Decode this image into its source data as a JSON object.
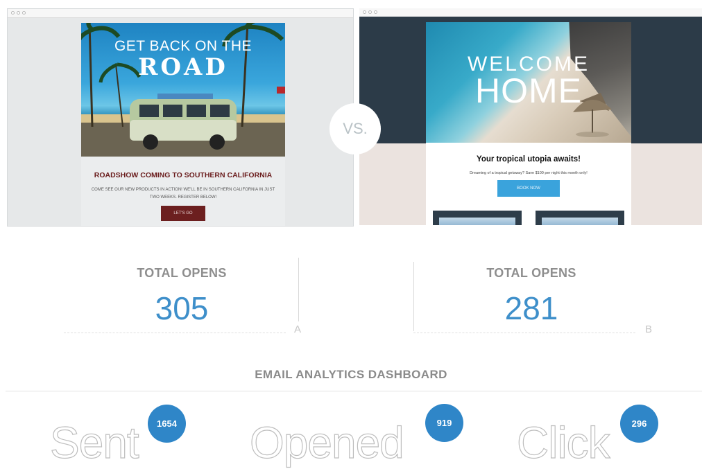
{
  "variant_a": {
    "hero_line1": "GET BACK ON THE",
    "hero_line2": "ROAD",
    "headline": "ROADSHOW COMING TO SOUTHERN CALIFORNIA",
    "body": "COME SEE OUR NEW PRODUCTS IN ACTION! WE'LL BE IN SOUTHERN CALIFORNIA IN JUST TWO WEEKS. REGISTER BELOW!",
    "button": "LET'S GO",
    "stat_label": "TOTAL OPENS",
    "stat_value": "305",
    "variant_letter": "A"
  },
  "variant_b": {
    "hero_line1": "WELCOME",
    "hero_line2": "HOME",
    "headline": "Your tropical utopia awaits!",
    "subtext": "Dreaming of a tropical getaway? Save $100 per night this month only!",
    "button": "BOOK NOW",
    "stat_label": "TOTAL OPENS",
    "stat_value": "281",
    "variant_letter": "B"
  },
  "vs_label": "VS.",
  "dashboard": {
    "title": "EMAIL ANALYTICS DASHBOARD",
    "metrics": [
      {
        "label": "Sent",
        "value": "1654"
      },
      {
        "label": "Opened",
        "value": "919"
      },
      {
        "label": "Click",
        "value": "296"
      }
    ]
  },
  "colors": {
    "accent_blue": "#3e8fca",
    "badge_blue": "#2f86c8",
    "variant_a_button": "#6c1f1f",
    "variant_b_button": "#3aa3dc",
    "variant_b_band": "#2c3b48"
  }
}
